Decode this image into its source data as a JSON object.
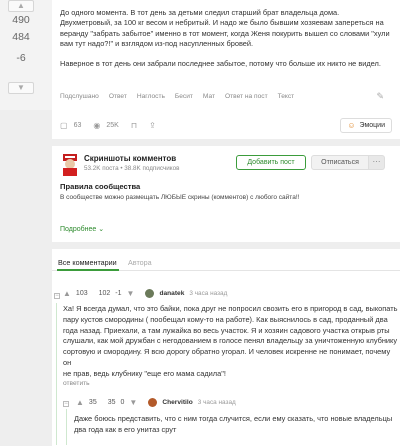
{
  "rating": {
    "up_arrow": "▲",
    "plus": "490",
    "minus": "484",
    "total": "-6",
    "down_arrow": "▼"
  },
  "post": {
    "paragraphs": [
      "До одного момента. В тот день за детьми следил старший брат владельца дома. Двухметровый, за 100 кг весом и небритый. И надо же было бывшим хозяевам запереться на веранду \"забрать забытое\" именно в тот момент, когда Женя покурить вышел со словами \"хули вам тут надо?!\" и взглядом из-под насупленных бровей.",
      "Наверное в тот день они забрали последнее забытое, потому что больше их никто не видел."
    ],
    "reactions": [
      "Подслушано",
      "Ответ",
      "Наглость",
      "Бесит",
      "Мат",
      "Ответ на пост",
      "Текст"
    ],
    "comments_count": "63",
    "views": "25K",
    "emotions_label": "Эмоции"
  },
  "community": {
    "name": "Скриншоты комментов",
    "meta": "53.2K поста • 38.8K подписчиков",
    "add_post_label": "Добавить пост",
    "unsubscribe_label": "Отписаться",
    "more_label": "···",
    "rules_title": "Правила сообщества",
    "rules_text": "В сообществе можно размещать ЛЮБЫЕ скрины (комментов) с любого сайта!!",
    "more_link": "Подробнее ⌄"
  },
  "comments_tabs": {
    "all": "Все комментарии",
    "author": "Автора"
  },
  "comments": [
    {
      "collapse": "−",
      "rating": "103",
      "plus": "102",
      "minus": "-1",
      "author": "danatek",
      "time": "3 часа назад",
      "avatar_color": "#6b7a5a",
      "text": [
        "Ха! Я всегда думал, что это байки, пока друг не попросил свозить его в пригород в сад, выкопать",
        "пару кустов смородины ( пообещал кому-то на работе). Как выяснилось в сад, проданный два",
        "года назад. Приехали, а там лужайка во весь участок. Я и хозяин садового участка открыв рты",
        "слушали, как мой дружбан с негодованием в голосе пенял владельцу за уничтоженную клубнику",
        "сортовую и смородину. Я всю дорогу обратно угорал. И человек искренне не понимает, почему он",
        "не прав, ведь клубнику \"еще его мама садила\"!"
      ],
      "reply": "ответить"
    },
    {
      "collapse": "−",
      "rating": "35",
      "plus": "35",
      "minus": "0",
      "author": "Chervitilo",
      "time": "3 часа назад",
      "avatar_color": "#b35a2a",
      "text": [
        "Даже боюсь представить, что с ним тогда случится, если ему сказать, что новые владельцы",
        "два года как в его унитаз срут"
      ]
    }
  ],
  "colors": {
    "accent_green": "#3b9c3b",
    "background": "#eeeeee"
  }
}
